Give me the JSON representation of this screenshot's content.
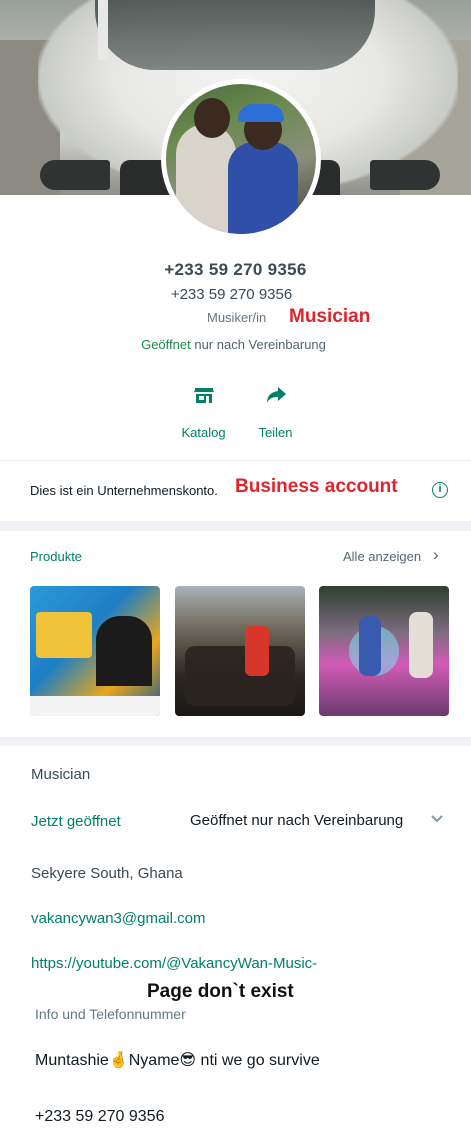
{
  "profile": {
    "title_phone": "+233 59 270 9356",
    "subtitle_phone": "+233 59 270 9356",
    "category": "Musiker/in",
    "category_annotation": "Musician",
    "hours_open": "Geöffnet",
    "hours_rest": " nur nach Vereinbarung"
  },
  "actions": {
    "catalog_label": "Katalog",
    "share_label": "Teilen",
    "catalog_icon": "storefront-icon",
    "share_icon": "share-arrow-icon"
  },
  "business": {
    "text": "Dies ist ein Unternehmenskonto.",
    "annotation": "Business account",
    "info_icon": "i"
  },
  "products": {
    "label": "Produkte",
    "see_all": "Alle anzeigen",
    "chevron": "›"
  },
  "details": {
    "category": "Musician",
    "open_now": "Jetzt geöffnet",
    "hours_value": "Geöffnet nur nach Vereinbarung",
    "location": "Sekyere South, Ghana",
    "email": "vakancywan3@gmail.com",
    "website": "https://youtube.com/@VakancyWan-Music-",
    "website_annotation": "Page don`t exist",
    "info_label": "Info und Telefonnummer",
    "about": "Muntashie🤞Nyame😎 nti we go survive",
    "phone": "+233 59 270 9356"
  },
  "colors": {
    "accent": "#008069",
    "annotation_red": "#e0242b",
    "open_green": "#1e8a4a"
  }
}
